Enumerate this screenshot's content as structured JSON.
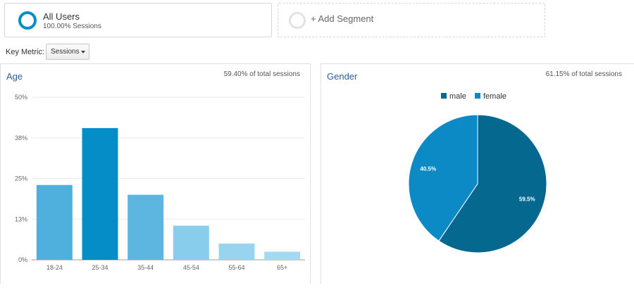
{
  "segments": {
    "primary": {
      "name": "All Users",
      "subtitle": "100.00% Sessions"
    },
    "add_label": "+ Add Segment"
  },
  "key_metric": {
    "label": "Key Metric:",
    "selected": "Sessions"
  },
  "colors": {
    "ring": "#058dc7",
    "gender_male": "#05698f",
    "gender_female": "#0b8ac6"
  },
  "chart_data": [
    {
      "type": "bar",
      "title": "Age",
      "subtitle": "59.40% of total sessions",
      "categories": [
        "18-24",
        "25-34",
        "35-44",
        "45-54",
        "55-64",
        "65+"
      ],
      "values": [
        23,
        40.5,
        20,
        10.5,
        5,
        2.5
      ],
      "value_unit": "%",
      "ylim": [
        0,
        50
      ],
      "yticks": [
        0,
        12.5,
        25,
        37.5,
        50
      ],
      "ytick_labels": [
        "0%",
        "13%",
        "25%",
        "38%",
        "50%"
      ],
      "colors": [
        "#4fb0de",
        "#058dc7",
        "#5db6e0",
        "#88cdec",
        "#99d4ef",
        "#a4d9f1"
      ],
      "grid": true
    },
    {
      "type": "pie",
      "title": "Gender",
      "subtitle": "61.15% of total sessions",
      "labels": [
        "male",
        "female"
      ],
      "values": [
        59.5,
        40.5
      ],
      "value_labels": [
        "59.5%",
        "40.5%"
      ],
      "colors": [
        "#05698f",
        "#0b8ac6"
      ],
      "legend": "top"
    }
  ]
}
